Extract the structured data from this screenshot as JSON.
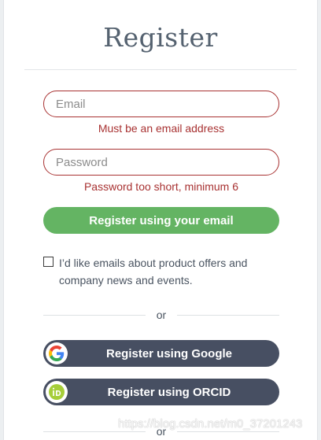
{
  "form": {
    "title": "Register",
    "email": {
      "placeholder": "Email",
      "value": "",
      "error": "Must be an email address"
    },
    "password": {
      "placeholder": "Password",
      "value": "",
      "error": "Password too short, minimum 6"
    },
    "submit_label": "Register using your email",
    "consent_text": "I’d like emails about product offers and company news and events.",
    "consent_checked": false,
    "divider_text": "or",
    "google_label": "Register using Google",
    "orcid_label": "Register using ORCID",
    "bottom_divider_text": "or"
  },
  "colors": {
    "error": "#a83232",
    "primary_button": "#64b463",
    "social_button": "#474f62",
    "orcid_green": "#a6ce39"
  },
  "icons": {
    "google": "google-icon",
    "orcid": "orcid-icon",
    "checkbox": "checkbox"
  },
  "watermark": "https://blog.csdn.net/m0_37201243"
}
